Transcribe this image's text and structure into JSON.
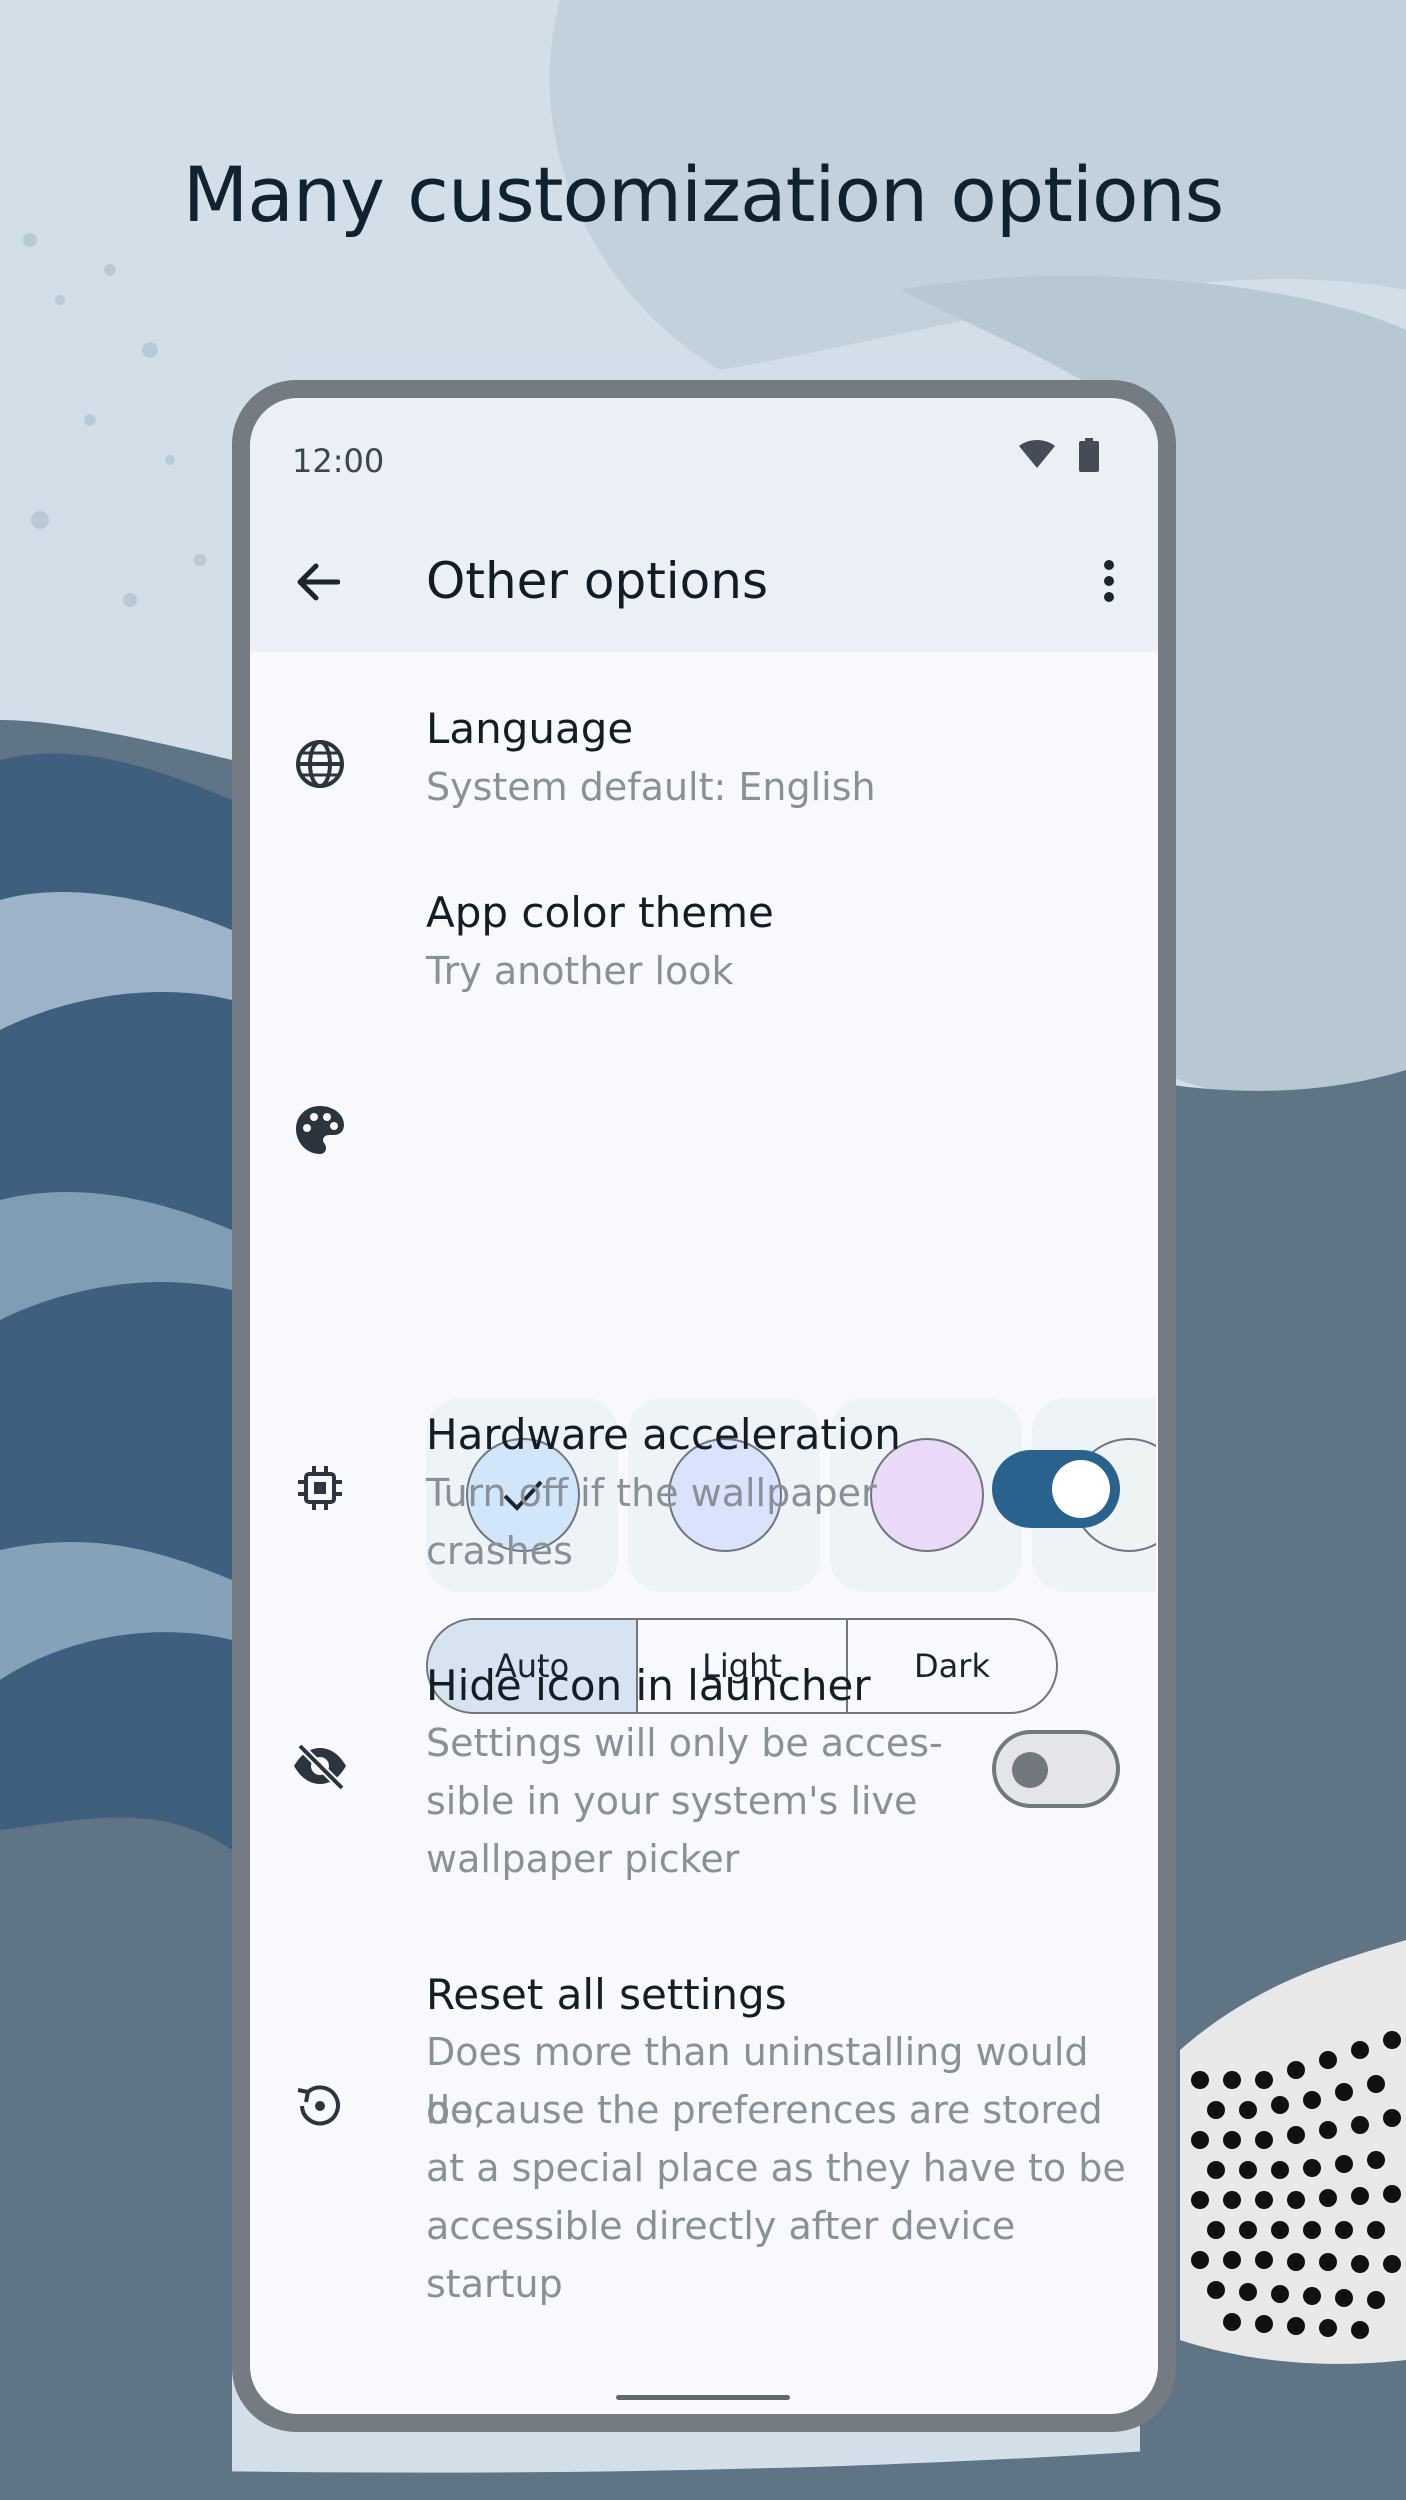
{
  "headline": "Many customization options",
  "status": {
    "time": "12:00",
    "wifi_icon": "wifi-icon",
    "battery_icon": "battery-icon"
  },
  "appbar": {
    "title": "Other options",
    "back_icon": "arrow-back-icon",
    "more_icon": "more-vert-icon"
  },
  "language": {
    "title": "Language",
    "subtitle": "System default: English",
    "icon": "globe-icon"
  },
  "theme": {
    "title": "App color theme",
    "subtitle": "Try another look",
    "icon": "palette-icon",
    "swatches": [
      {
        "color": "#d2e6fb",
        "selected": true
      },
      {
        "color": "#dbe2fb",
        "selected": false
      },
      {
        "color": "#ead9f7",
        "selected": false
      },
      {
        "color": "#eef3f4",
        "selected": false
      }
    ],
    "modes": [
      "Auto",
      "Light",
      "Dark"
    ],
    "selected_mode": "Auto"
  },
  "hardware": {
    "title": "Hardware acceleration",
    "subtitle_line1": "Turn off if the wallpaper",
    "subtitle_line2": "crashes",
    "icon": "chip-icon",
    "enabled": true
  },
  "hide_icon": {
    "title": "Hide icon in launcher",
    "subtitle_line1": "Settings will only be acces-",
    "subtitle_line2": "sible in your system's live",
    "subtitle_line3": "wallpaper picker",
    "icon": "visibility-off-icon",
    "enabled": false
  },
  "reset": {
    "title": "Reset all settings",
    "subtitle_line1": "Does more than uninstalling would do,",
    "subtitle_line2": "because the preferences are stored",
    "subtitle_line3": "at a special place as they have to be",
    "subtitle_line4": "accessible directly after device startup",
    "icon": "restore-icon"
  },
  "colors": {
    "accent": "#2a628e",
    "toggle_off": "#e3e5ea",
    "surface": "#f8f9fd",
    "appbar": "#ebf0f6"
  }
}
